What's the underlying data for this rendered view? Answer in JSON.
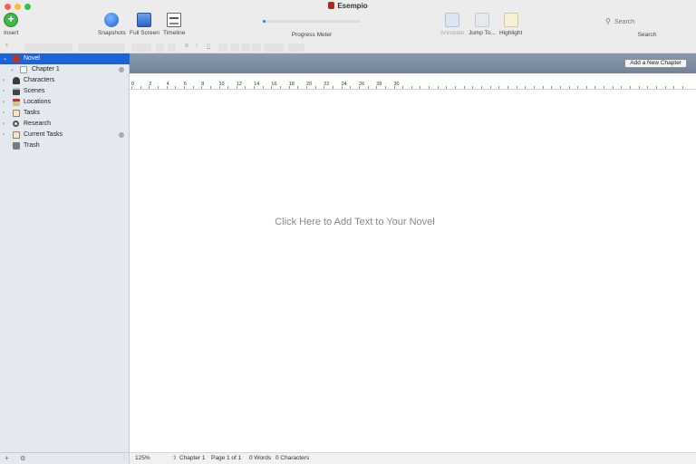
{
  "window": {
    "title": "Esempio"
  },
  "toolbar": {
    "insert_label": "Insert",
    "snapshots_label": "Snapshots",
    "fullscreen_label": "Full Screen",
    "timeline_label": "Timeline",
    "progress_label": "Progress Meter",
    "progress_value": 0.03,
    "annotate_label": "Annotate",
    "jump_label": "Jump To...",
    "highlight_label": "Highlight",
    "search_placeholder": "Search",
    "search_label": "Search"
  },
  "formatbar": {
    "bold": "B",
    "italic": "I",
    "underline": "U",
    "paragraph": "¶"
  },
  "binder": {
    "items": [
      {
        "label": "Novel",
        "level": 0,
        "expanded": true,
        "selected": true,
        "icon": "manuscript-icon"
      },
      {
        "label": "Chapter 1",
        "level": 1,
        "expanded": true,
        "selected": false,
        "icon": "chapter-folder-icon",
        "badge": true
      },
      {
        "label": "Characters",
        "level": 0,
        "expanded": false,
        "selected": false,
        "icon": "person-icon"
      },
      {
        "label": "Scenes",
        "level": 0,
        "expanded": false,
        "selected": false,
        "icon": "clapperboard-icon"
      },
      {
        "label": "Locations",
        "level": 0,
        "expanded": false,
        "selected": false,
        "icon": "map-pin-icon"
      },
      {
        "label": "Tasks",
        "level": 0,
        "expanded": false,
        "selected": false,
        "icon": "notepad-icon"
      },
      {
        "label": "Research",
        "level": 0,
        "expanded": false,
        "selected": false,
        "icon": "magnifier-icon"
      },
      {
        "label": "Current Tasks",
        "level": 0,
        "expanded": false,
        "selected": false,
        "icon": "notepad-icon",
        "badge": true
      },
      {
        "label": "Trash",
        "level": 0,
        "expanded": false,
        "selected": false,
        "icon": "trash-icon"
      }
    ],
    "footer_add": "+",
    "footer_gear": "⚙"
  },
  "editor": {
    "add_chapter_label": "Add a New Chapter",
    "ruler_numbers": [
      "0",
      "2",
      "4",
      "6",
      "8",
      "10",
      "12",
      "14",
      "16",
      "18",
      "20",
      "22",
      "24",
      "26",
      "28",
      "30"
    ],
    "placeholder": "Click Here to Add Text to Your Novel"
  },
  "statusbar": {
    "zoom": "125%",
    "chapter": "Chapter 1",
    "page": "Page 1 of 1",
    "words": "0 Words",
    "characters": "0 Characters"
  },
  "colors": {
    "selection": "#1d63d8",
    "insert_green": "#3fb64a",
    "progress_blue": "#2f7cf6"
  }
}
